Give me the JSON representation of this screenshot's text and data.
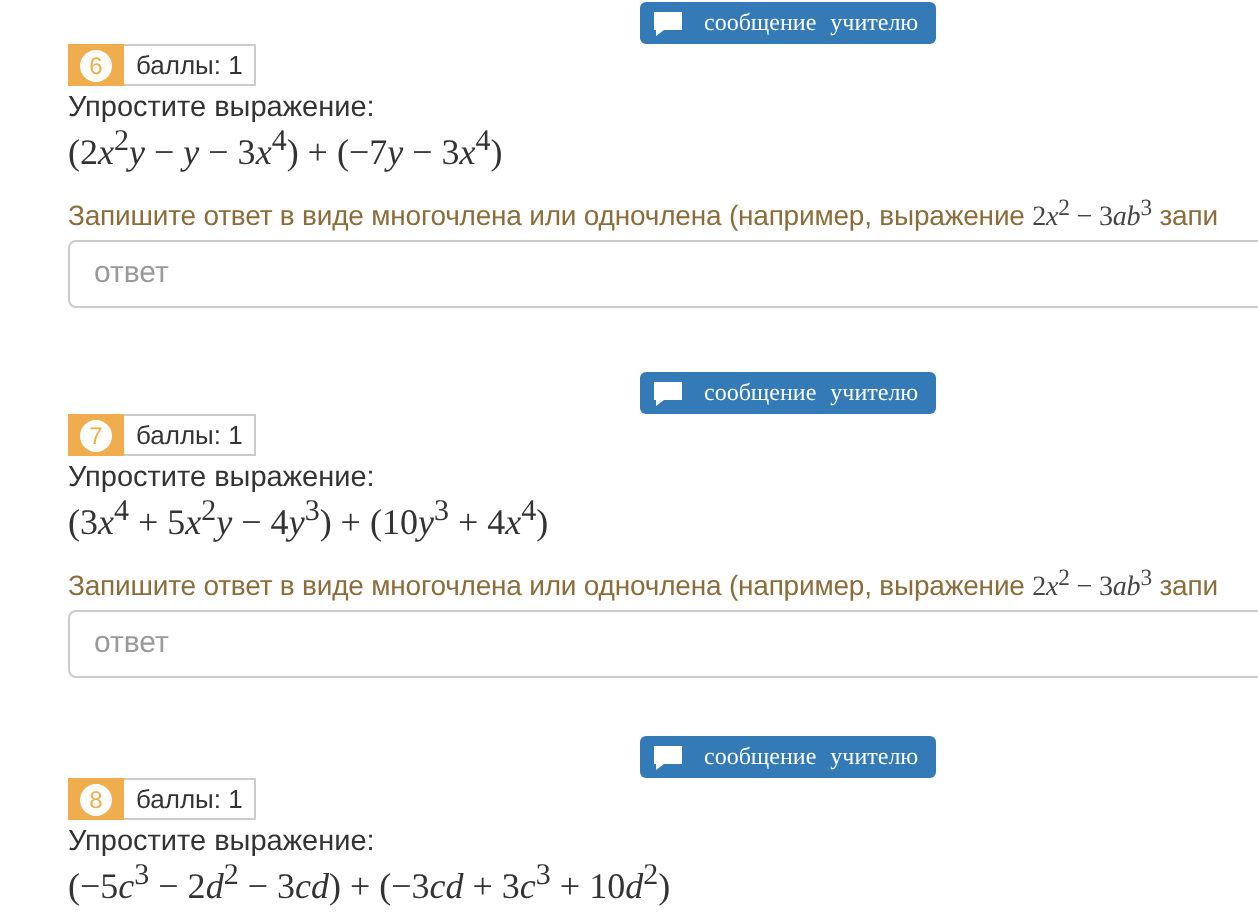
{
  "questions": [
    {
      "number": "6",
      "button": "сообщение учителю",
      "score": "баллы: 1",
      "prompt": "Упростите выражение:",
      "expression": [
        "(2",
        "*x*",
        "$^{2}$",
        "*y*",
        " − ",
        "*y*",
        " − 3",
        "*x*",
        "$^{4}$",
        ") + (−7",
        "*y*",
        " − 3",
        "*x*",
        "$^{4}$",
        ")"
      ],
      "instruction": [
        "Запишите ответ в виде многочлена или одночлена (например, выражение ",
        "2",
        "*x*",
        "$^{2}$",
        " − 3",
        "*ab*",
        "$^{3}$",
        " запи"
      ],
      "answer": {
        "placeholder": "ответ"
      }
    },
    {
      "number": "7",
      "button": "сообщение учителю",
      "score": "баллы: 1",
      "prompt": "Упростите выражение:",
      "expression": [
        "(3",
        "*x*",
        "$^{4}$",
        " + 5",
        "*x*",
        "$^{2}$",
        "*y*",
        " − 4",
        "*y*",
        "$^{3}$",
        ") + (10",
        "*y*",
        "$^{3}$",
        " + 4",
        "*x*",
        "$^{4}$",
        ")"
      ],
      "instruction": [
        "Запишите ответ в виде многочлена или одночлена (например, выражение ",
        "2",
        "*x*",
        "$^{2}$",
        " − 3",
        "*ab*",
        "$^{3}$",
        " запи"
      ],
      "answer": {
        "placeholder": "ответ"
      }
    },
    {
      "number": "8",
      "button": "сообщение учителю",
      "score": "баллы: 1",
      "prompt": "Упростите выражение:",
      "expression": [
        "(−5",
        "*c*",
        "$^{3}$",
        " − 2",
        "*d*",
        "$^{2}$",
        " − 3",
        "*cd*",
        ") + (−3",
        "*cd*",
        " + 3",
        "*c*",
        "$^{3}$",
        " + 10",
        "*d*",
        "$^{2}$",
        ")"
      ]
    }
  ]
}
